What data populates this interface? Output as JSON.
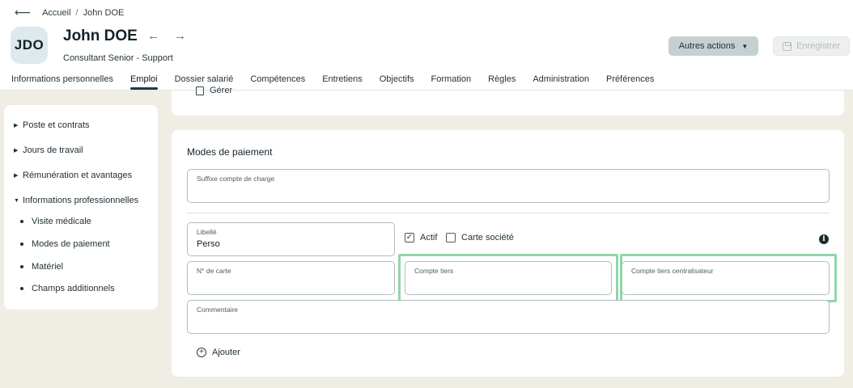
{
  "breadcrumb": {
    "home": "Accueil",
    "separator": "/",
    "current": "John DOE"
  },
  "employee": {
    "initials": "JDO",
    "name": "John DOE",
    "title": "Consultant Senior - Support"
  },
  "nav_arrows": {
    "prev": "←",
    "next": "→"
  },
  "actions": {
    "more_actions": "Autres actions",
    "save": "Enregistrer"
  },
  "tabs": [
    {
      "label": "Informations personnelles"
    },
    {
      "label": "Emploi",
      "active": true
    },
    {
      "label": "Dossier salarié"
    },
    {
      "label": "Compétences"
    },
    {
      "label": "Entretiens"
    },
    {
      "label": "Objectifs"
    },
    {
      "label": "Formation"
    },
    {
      "label": "Règles"
    },
    {
      "label": "Administration"
    },
    {
      "label": "Préférences"
    }
  ],
  "sidebar": {
    "sections": [
      {
        "label": "Poste et contrats",
        "expanded": false
      },
      {
        "label": "Jours de travail",
        "expanded": false
      },
      {
        "label": "Rémunération et avantages",
        "expanded": false
      },
      {
        "label": "Informations professionnelles",
        "expanded": true
      }
    ],
    "subitems": [
      {
        "label": "Visite médicale"
      },
      {
        "label": "Modes de paiement"
      },
      {
        "label": "Matériel"
      },
      {
        "label": "Champs additionnels"
      }
    ]
  },
  "top_card": {
    "manage_label": "Gérer"
  },
  "payment": {
    "title": "Modes de paiement",
    "suffix_label": "Suffixe compte de charge",
    "suffix_value": "",
    "libelle_label": "Libellé",
    "libelle_value": "Perso",
    "actif_label": "Actif",
    "actif_checked": true,
    "company_card_label": "Carte société",
    "company_card_checked": false,
    "card_number_label": "N° de carte",
    "third_account_label": "Compte tiers",
    "central_account_label": "Compte tiers centralisateur",
    "comment_label": "Commentaire",
    "add_label": "Ajouter"
  },
  "colors": {
    "highlight": "#8fd6a8",
    "background": "#f0ede4",
    "active_tab": "#1b3a46"
  }
}
